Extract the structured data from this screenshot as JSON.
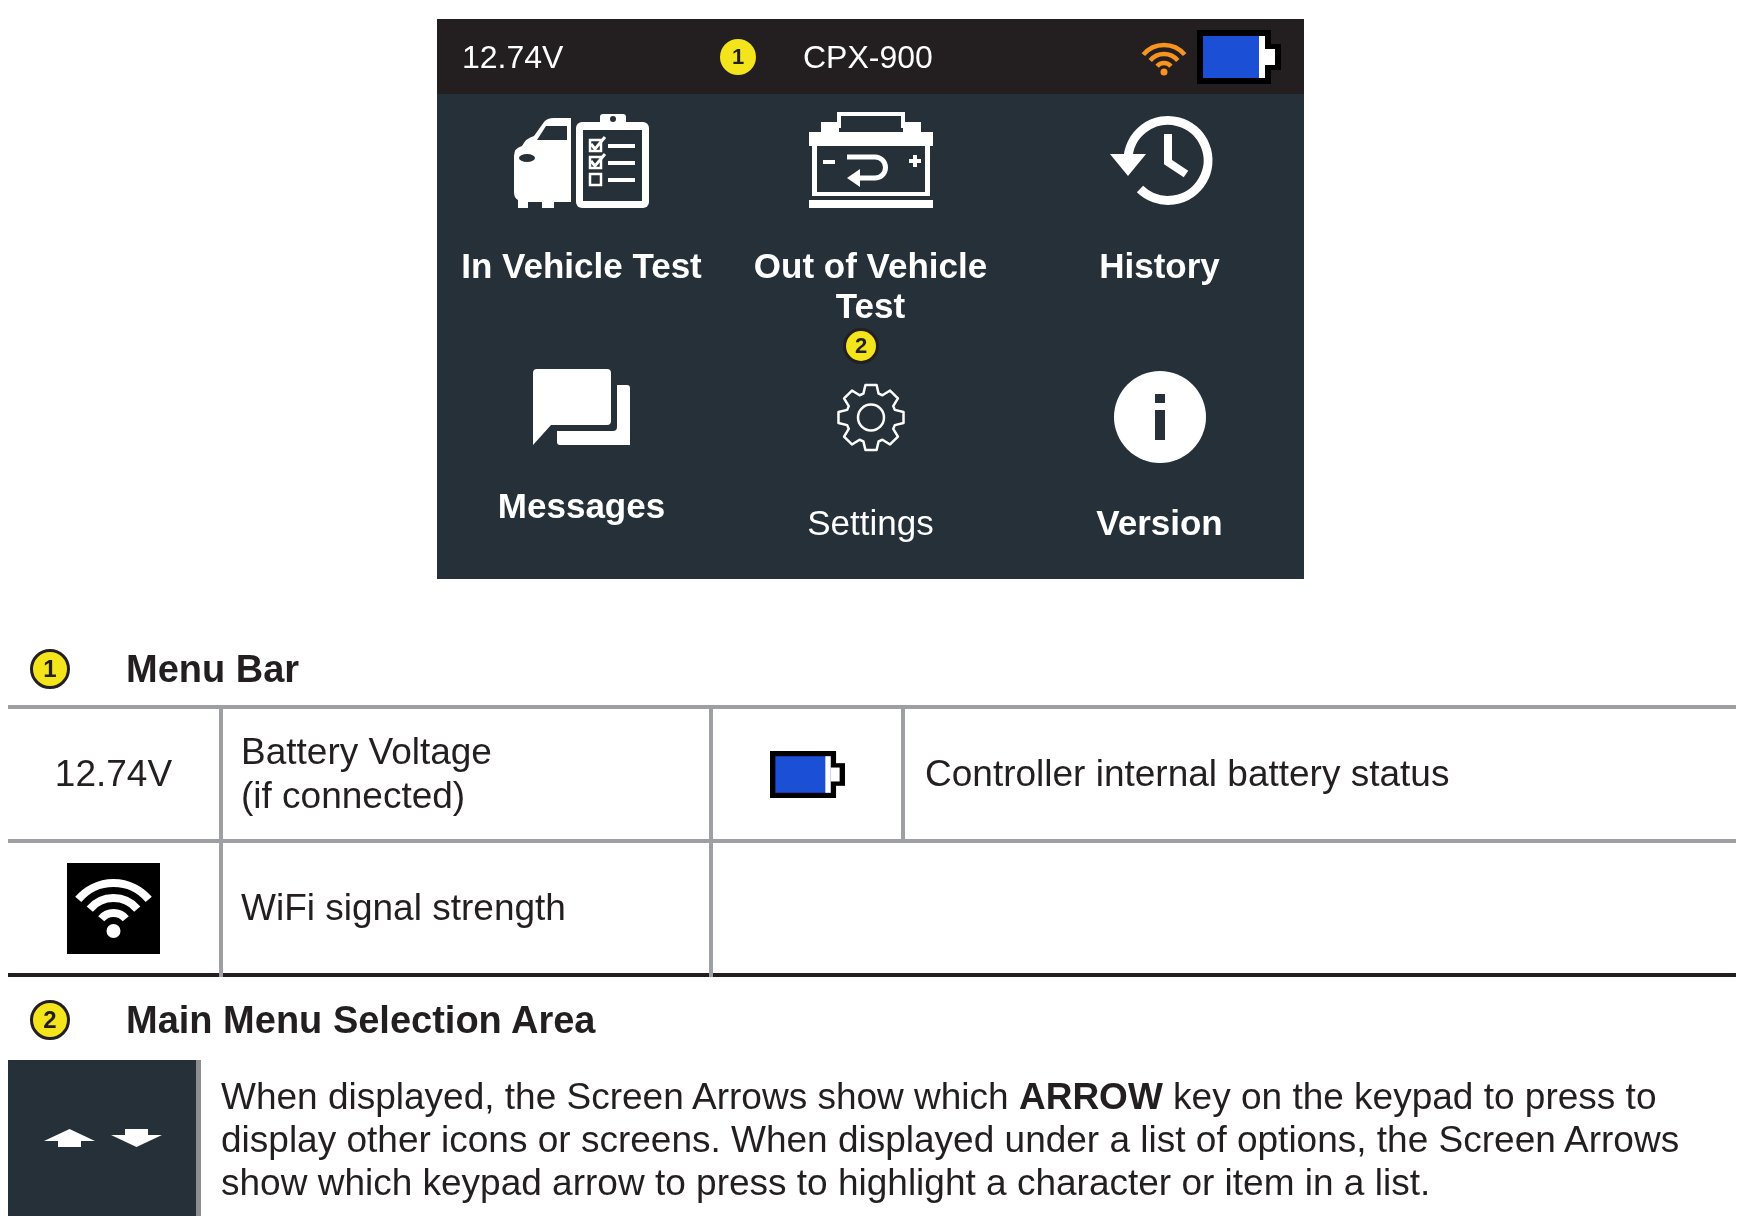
{
  "device_screen": {
    "status_bar": {
      "voltage": "12.74V",
      "callout": "1",
      "model": "CPX-900"
    },
    "menu_items": [
      {
        "label": "In Vehicle Test"
      },
      {
        "label": "Out of Vehicle Test"
      },
      {
        "label": "History"
      },
      {
        "label": "Messages"
      },
      {
        "label": "Settings"
      },
      {
        "label": "Version"
      }
    ],
    "callout": "2"
  },
  "legend": [
    {
      "kind": "table",
      "callout": "1",
      "title": "Menu Bar",
      "table": {
        "rows": [
          {
            "cells": [
              {
                "kind": "value",
                "text": "12.74V"
              },
              {
                "kind": "text",
                "text": "Battery Voltage\n(if connected)"
              },
              {
                "kind": "battery"
              },
              {
                "kind": "text",
                "text": "Controller internal battery status"
              }
            ]
          },
          {
            "cells": [
              {
                "kind": "wifi"
              },
              {
                "kind": "text",
                "text": "WiFi signal strength"
              }
            ]
          }
        ]
      }
    },
    {
      "kind": "note",
      "callout": "2",
      "title": "Main Menu Selection Area",
      "description": "When displayed, the Screen Arrows show which **ARROW** key on the keypad to press to display other icons or screens. When displayed under a list of options, the Screen Arrows show which keypad arrow to press to highlight a character or item in a list."
    }
  ]
}
